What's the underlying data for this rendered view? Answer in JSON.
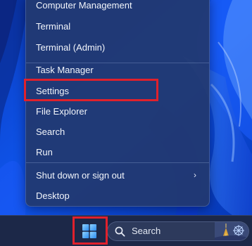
{
  "menu": {
    "items": [
      {
        "label": "Computer Management"
      },
      {
        "label": "Terminal"
      },
      {
        "label": "Terminal (Admin)"
      },
      {
        "label": "Task Manager"
      },
      {
        "label": "Settings",
        "highlighted": true
      },
      {
        "label": "File Explorer"
      },
      {
        "label": "Search"
      },
      {
        "label": "Run"
      },
      {
        "label": "Shut down or sign out",
        "has_submenu": true,
        "submenu_icon": "chevron-right-icon"
      },
      {
        "label": "Desktop"
      }
    ]
  },
  "taskbar": {
    "start_icon": "windows-logo-icon",
    "search": {
      "label": "Search",
      "icon": "search-icon"
    }
  },
  "colors": {
    "highlight_outline": "#e0212c",
    "menu_background": "#223870",
    "taskbar_background": "#1c2848",
    "wallpaper_blue": "#0a49d8"
  }
}
